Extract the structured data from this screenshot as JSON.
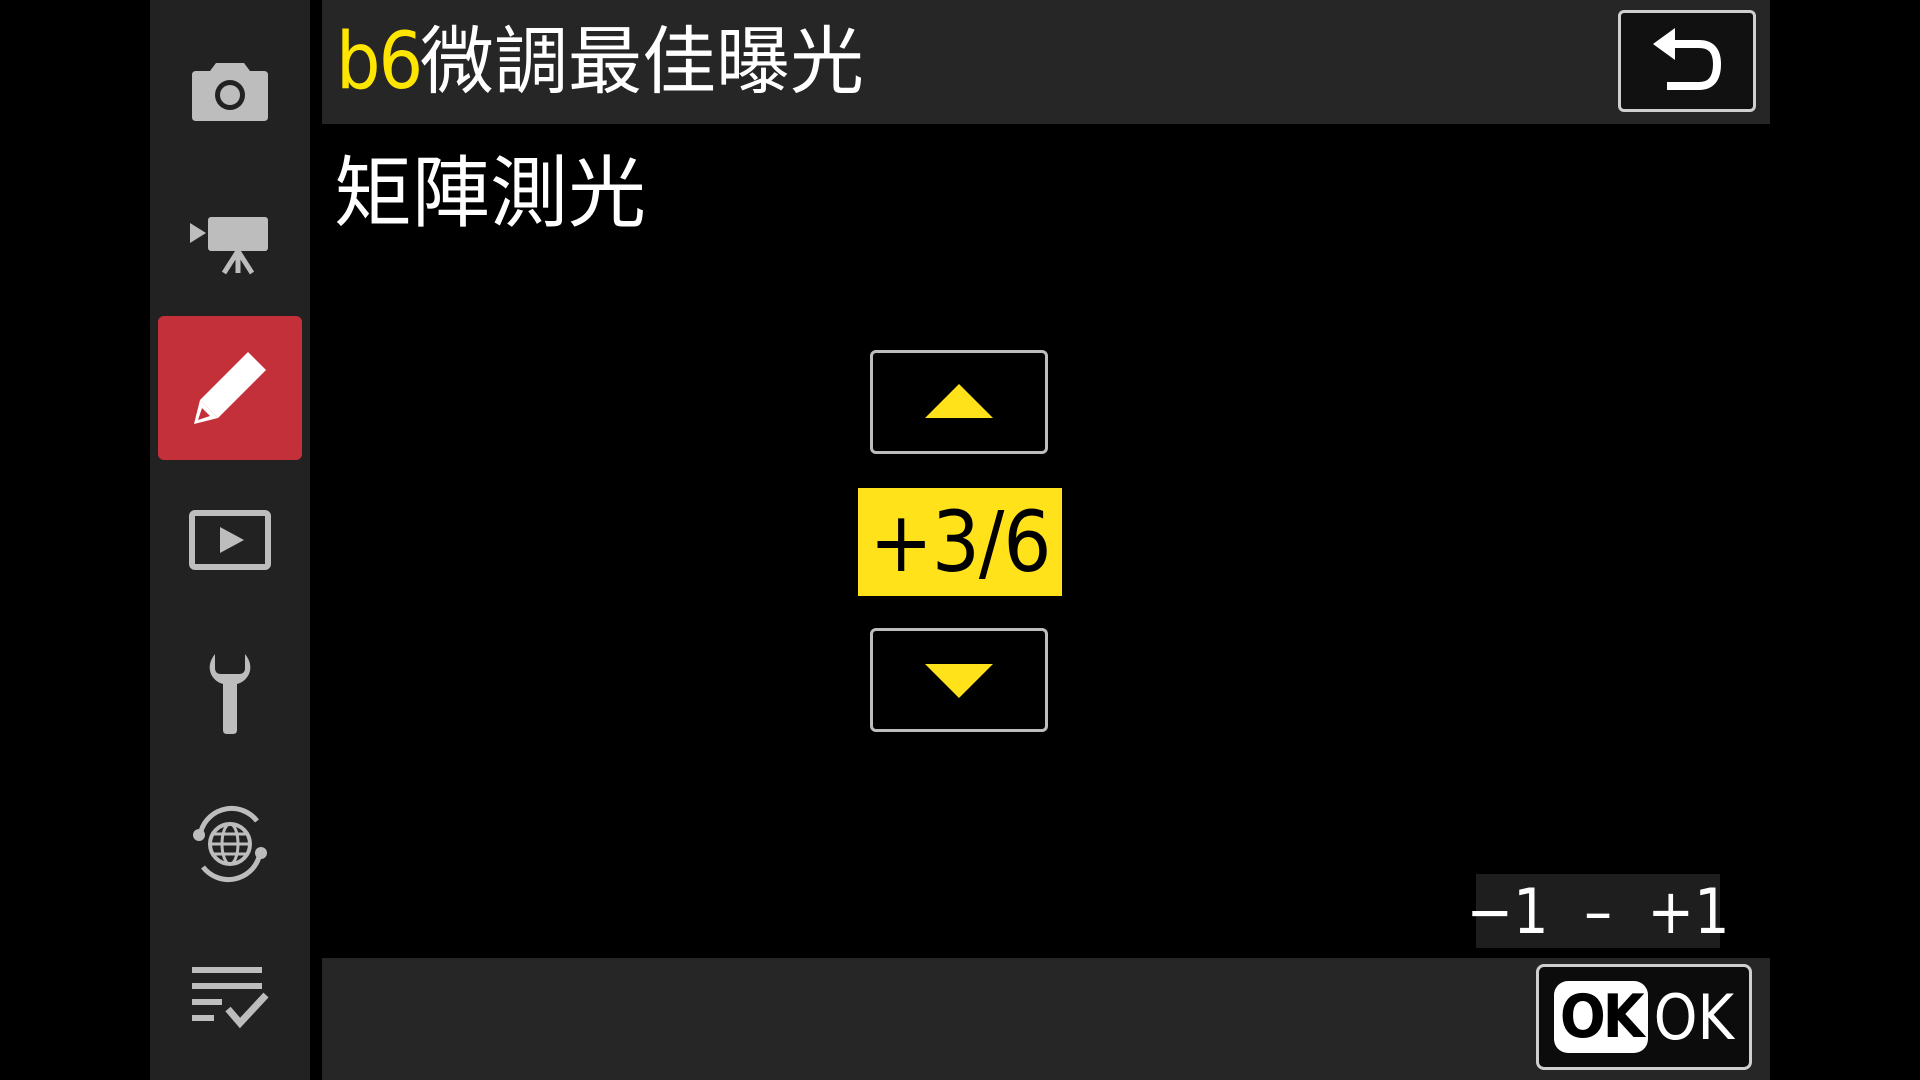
{
  "sidebar": {
    "items": [
      {
        "icon": "camera-icon"
      },
      {
        "icon": "movie-camera-icon"
      },
      {
        "icon": "pencil-icon",
        "active": true
      },
      {
        "icon": "playback-icon"
      },
      {
        "icon": "wrench-icon"
      },
      {
        "icon": "network-globe-icon"
      },
      {
        "icon": "my-menu-checklist-icon"
      }
    ],
    "active_color": "#c4303a"
  },
  "header": {
    "code": "b6",
    "title": "微調最佳曝光",
    "back_icon": "return-arrow-icon"
  },
  "subtitle": "矩陣測光",
  "stepper": {
    "value": "+3/6",
    "up_icon": "triangle-up-icon",
    "down_icon": "triangle-down-icon",
    "highlight_color": "#ffe21a",
    "arrow_color": "#ffe21a"
  },
  "range": {
    "text": "−1  –  +1"
  },
  "footer": {
    "ok_badge": "OK",
    "ok_label": "OK"
  }
}
